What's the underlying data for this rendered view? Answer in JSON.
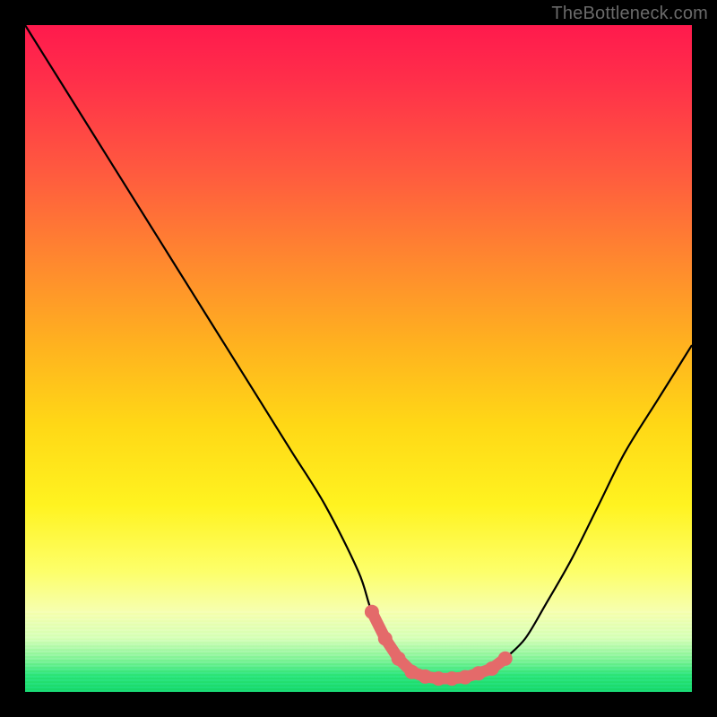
{
  "watermark": "TheBottleneck.com",
  "colors": {
    "frame": "#000000",
    "curve_stroke": "#000000",
    "marker_fill": "#e46a6a",
    "gradient_top": "#ff1a4d",
    "gradient_bottom": "#17d96e"
  },
  "chart_data": {
    "type": "line",
    "title": "",
    "xlabel": "",
    "ylabel": "",
    "xlim": [
      0,
      100
    ],
    "ylim": [
      0,
      100
    ],
    "grid": false,
    "series": [
      {
        "name": "bottleneck-curve",
        "x": [
          0,
          5,
          10,
          15,
          20,
          25,
          30,
          35,
          40,
          45,
          50,
          52,
          55,
          58,
          62,
          66,
          70,
          72,
          75,
          78,
          82,
          86,
          90,
          95,
          100
        ],
        "values": [
          100,
          92,
          84,
          76,
          68,
          60,
          52,
          44,
          36,
          28,
          18,
          12,
          6,
          3,
          2,
          2,
          3,
          5,
          8,
          13,
          20,
          28,
          36,
          44,
          52
        ]
      }
    ],
    "markers": {
      "name": "valley-highlight",
      "x": [
        52,
        54,
        56,
        58,
        60,
        62,
        64,
        66,
        68,
        70,
        72
      ],
      "values": [
        12,
        8,
        5,
        3,
        2.3,
        2,
        2,
        2.2,
        2.8,
        3.5,
        5
      ]
    },
    "background_gradient": {
      "orientation": "vertical",
      "stops": [
        {
          "pos": 0.0,
          "color": "#ff1a4d"
        },
        {
          "pos": 0.36,
          "color": "#ff8a2e"
        },
        {
          "pos": 0.6,
          "color": "#ffd816"
        },
        {
          "pos": 0.88,
          "color": "#f6ffb0"
        },
        {
          "pos": 1.0,
          "color": "#17d96e"
        }
      ]
    }
  }
}
